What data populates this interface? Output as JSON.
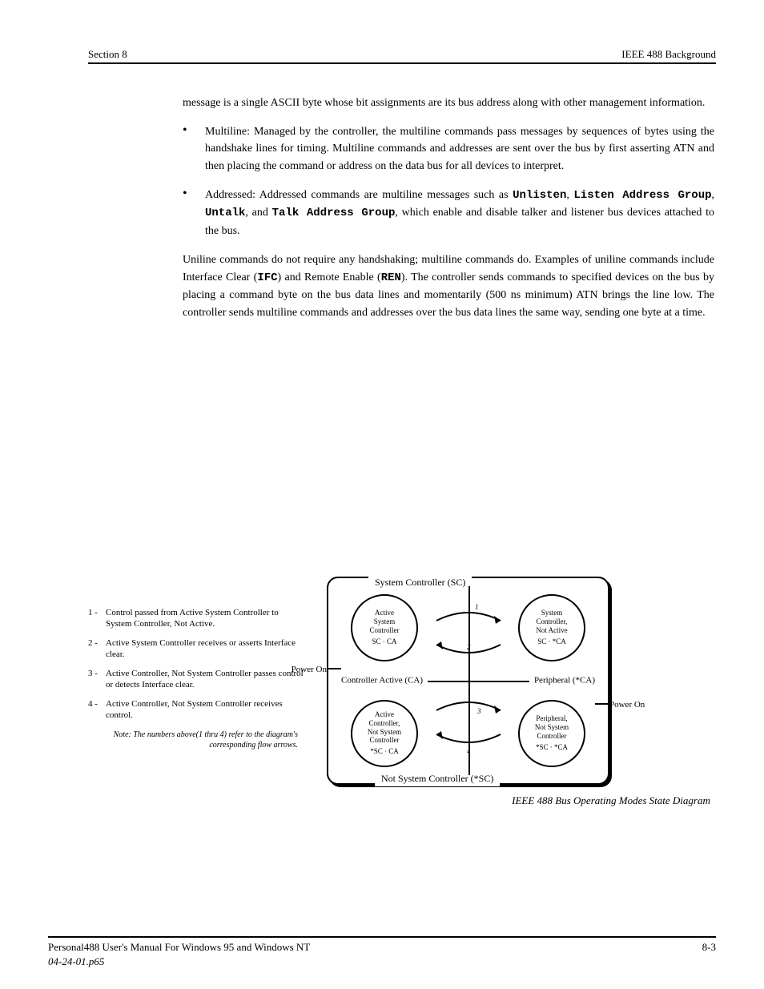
{
  "header": {
    "left": "Section 8",
    "right": "IEEE 488 Background"
  },
  "body": {
    "intro": "message is a single ASCII byte whose bit assignments are its bus address along with other management information.",
    "bullet1": "Multiline: Managed by the controller, the multiline commands pass messages by sequences of bytes using the handshake lines for timing. Multiline commands and addresses are sent over the bus by first asserting ATN and then placing the command or address on the data bus for all devices to interpret.",
    "bullet2_pre": "Addressed: Addressed commands are multiline messages such as ",
    "bullet2_tokens": {
      "a": "Unlisten",
      "b": "Listen Address Group",
      "c": "Untalk",
      "d": "Talk Address Group"
    },
    "bullet2_post": ", which enable and disable talker and listener bus devices attached to the bus.",
    "after": "Uniline commands do not require any handshaking; multiline commands do. Examples of uniline commands include Interface Clear (",
    "after_ifc": "IFC",
    "after_mid": ") and Remote Enable (",
    "after_ren": "REN",
    "after_tail": "). The controller sends commands to specified devices on the bus by placing a command byte on the bus data lines and momentarily (500 ns minimum) ATN brings the line low. The controller sends multiline commands and addresses over the bus data lines the same way, sending one byte at a time."
  },
  "legend": {
    "l1": {
      "num": "1 -",
      "txt": "Control passed from Active System Controller to System Controller, Not Active."
    },
    "l2": {
      "num": "2 -",
      "txt": "Active System Controller receives or asserts Interface clear."
    },
    "l3": {
      "num": "3 -",
      "txt": "Active Controller, Not System Controller passes control or detects Interface clear."
    },
    "l4": {
      "num": "4 -",
      "txt": "Active Controller, Not System Controller receives control."
    },
    "note": "Note:  The numbers above(1 thru 4) refer to the diagram's corresponding flow arrows."
  },
  "diagram": {
    "sc_top": "System Controller (SC)",
    "sc_bot": "Not System Controller (*SC)",
    "mid_left": "Controller Active (CA)",
    "mid_right": "Peripheral  (*CA)",
    "s_tl": {
      "t": "Active\nSystem\nController",
      "eq": "SC · CA"
    },
    "s_tr": {
      "t": "System\nController,\nNot  Active",
      "eq": "SC · *CA"
    },
    "s_bl": {
      "t": "Active\nController,\nNot  System\nController",
      "eq": "*SC · CA"
    },
    "s_br": {
      "t": "Peripheral,\nNot  System\nController",
      "eq": "*SC · *CA"
    },
    "power_on": "Power On",
    "n1": "1",
    "n2": "2",
    "n3": "3",
    "n4": "4",
    "caption": "IEEE 488 Bus Operating Modes State Diagram"
  },
  "footer": {
    "left": "Personal488 User's Manual For Windows 95 and Windows NT",
    "right": "8-3",
    "manual": "04-24-01.p65"
  }
}
